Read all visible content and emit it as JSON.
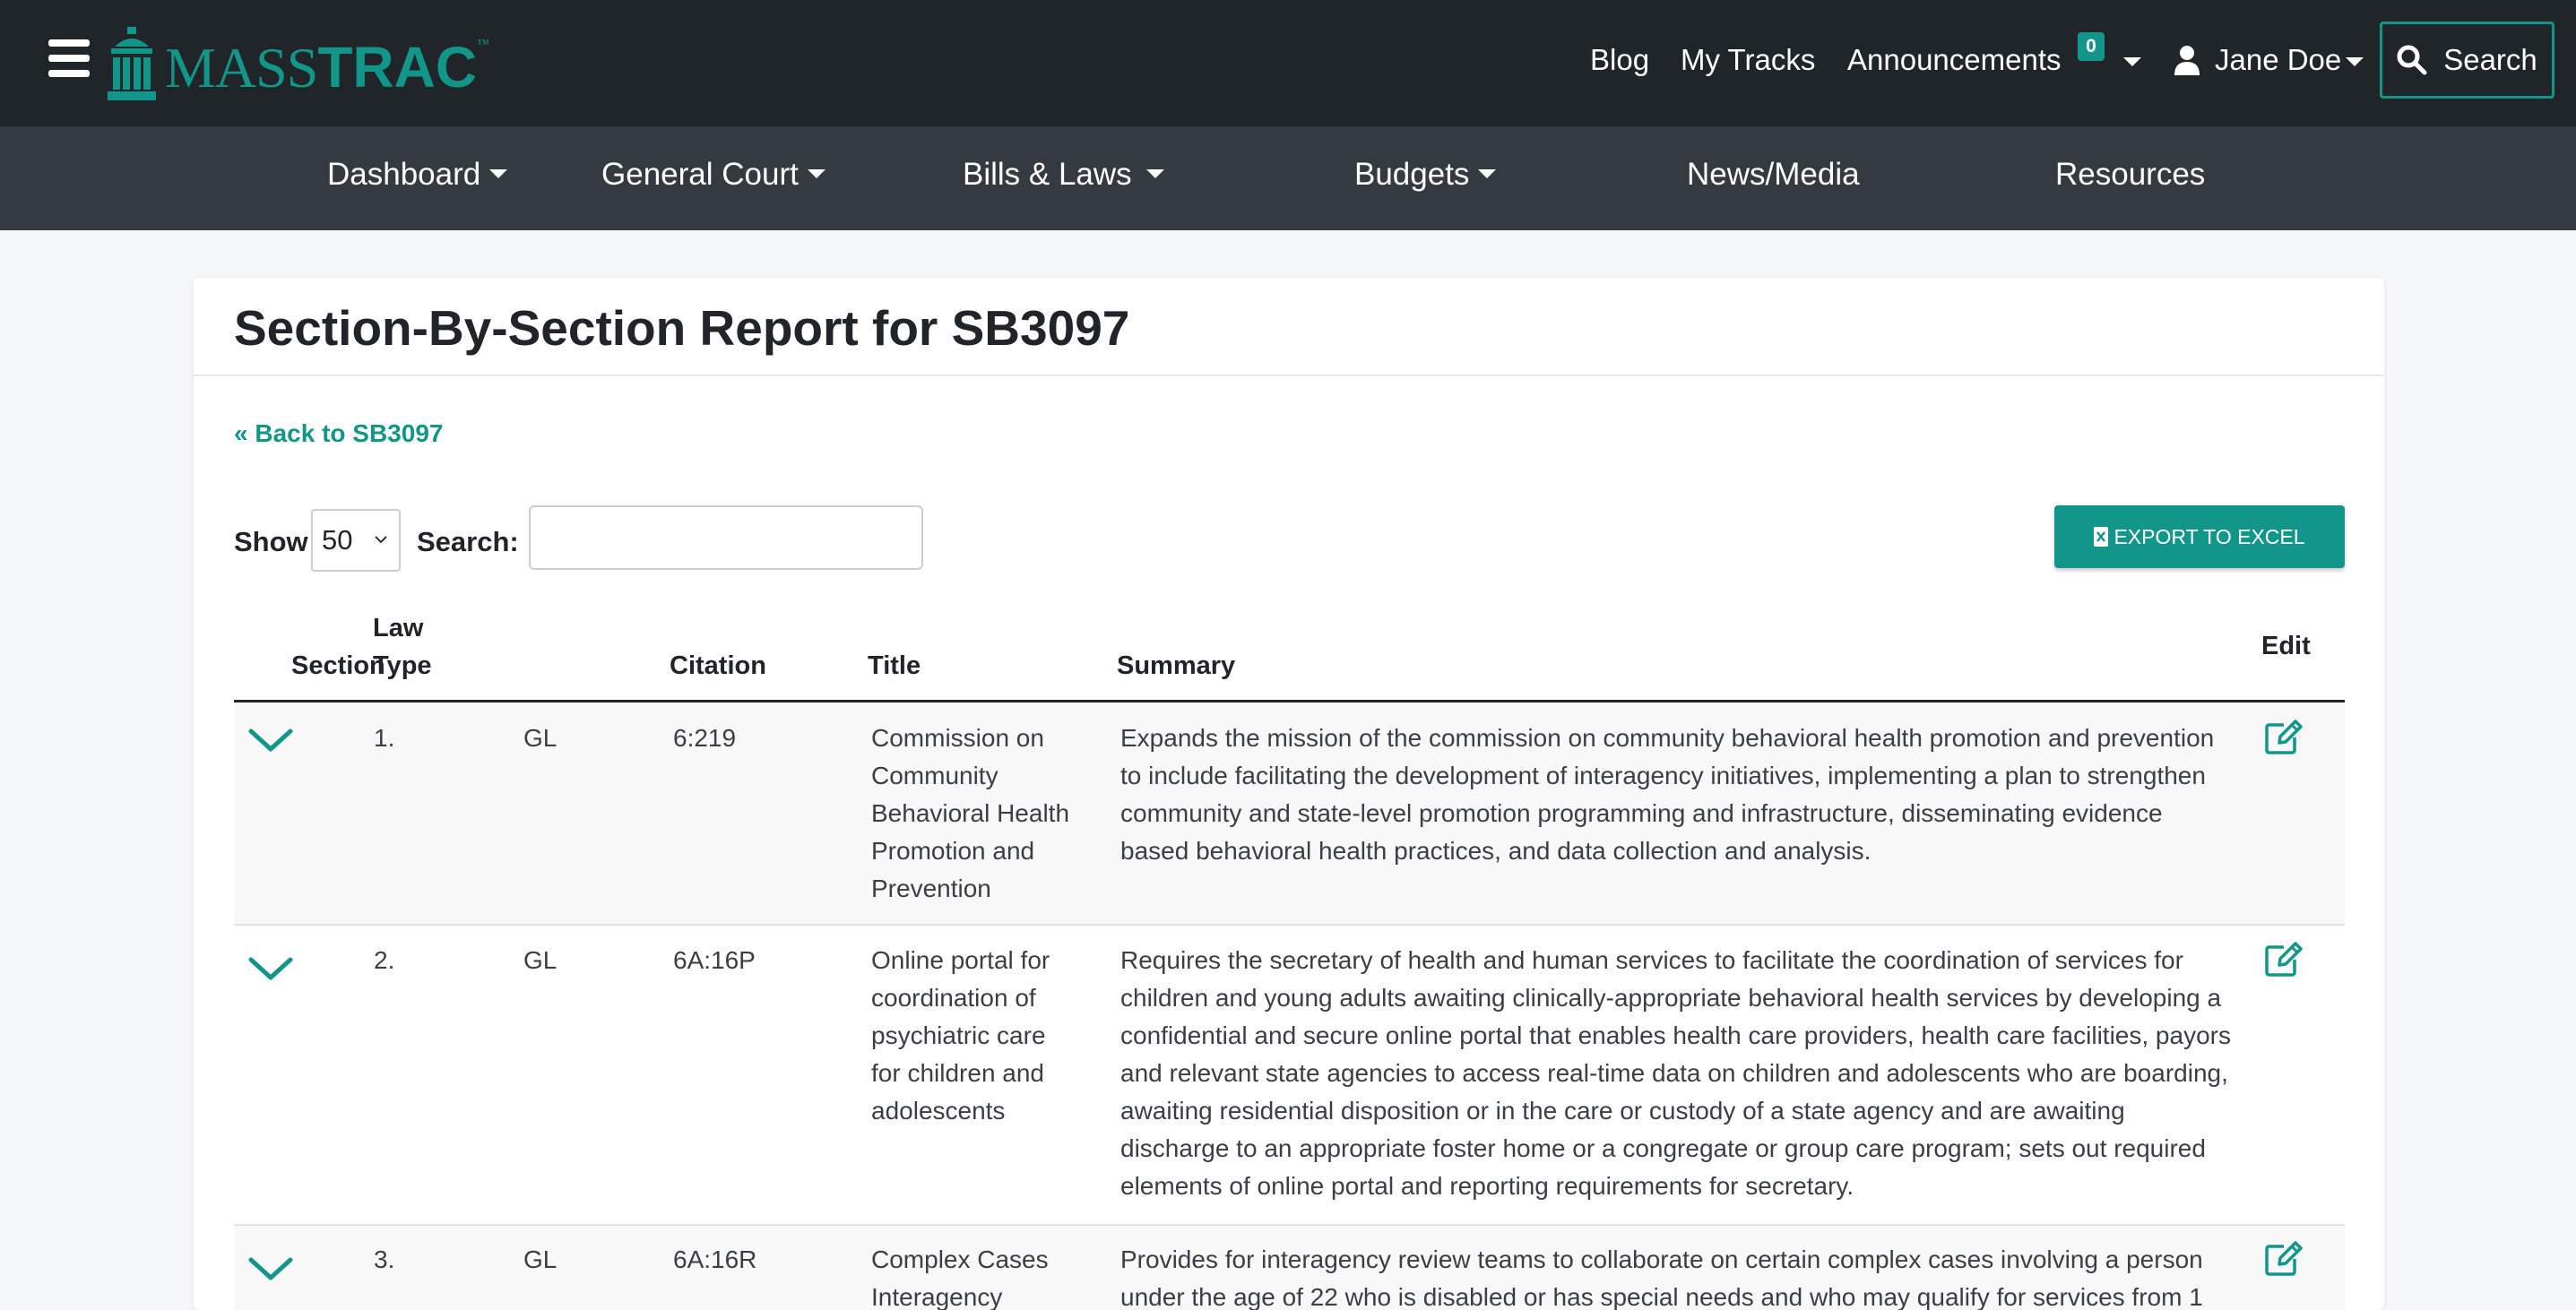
{
  "navbar": {
    "logo_text_light": "MASS",
    "logo_text_bold": "TRAC",
    "logo_tm": "™",
    "blog": "Blog",
    "my_tracks": "My Tracks",
    "announcements": "Announcements",
    "announcements_count": "0",
    "user_name": "Jane Doe",
    "search_label": "Search"
  },
  "subnav": {
    "items": [
      {
        "label": "Dashboard",
        "has_dropdown": true
      },
      {
        "label": "General Court",
        "has_dropdown": true
      },
      {
        "label": "Bills & Laws",
        "has_dropdown": true
      },
      {
        "label": "Budgets",
        "has_dropdown": true
      },
      {
        "label": "News/Media",
        "has_dropdown": false
      },
      {
        "label": "Resources",
        "has_dropdown": false
      }
    ]
  },
  "page": {
    "title": "Section-By-Section Report for SB3097",
    "back_link": "« Back to SB3097",
    "show_label": "Show",
    "show_value": "50",
    "search_label": "Search:",
    "search_value": "",
    "export_label": "EXPORT TO EXCEL"
  },
  "table": {
    "headers": {
      "section": "Section",
      "law_type_line1": "Law",
      "law_type_line2": "Type",
      "citation": "Citation",
      "title": "Title",
      "summary": "Summary",
      "edit": "Edit"
    },
    "rows": [
      {
        "section": "1.",
        "law_type": "GL",
        "citation": "6:219",
        "title": "Commission on Community Behavioral Health Promotion and Prevention",
        "summary": "Expands the mission of the commission on community behavioral health promotion and prevention to include facilitating the development of interagency initiatives, implementing a plan to strengthen community and state-level promotion programming and infrastructure, disseminating evidence based behavioral health practices, and data collection and analysis."
      },
      {
        "section": "2.",
        "law_type": "GL",
        "citation": "6A:16P",
        "title": "Online portal for coordination of psychiatric care for children and adolescents",
        "summary": "Requires the secretary of health and human services to facilitate the coordination of services for children and young adults awaiting clinically-appropriate behavioral health services by developing a confidential and secure online portal that enables health care providers, health care facilities, payors and relevant state agencies to access real-time data on children and adolescents who are boarding, awaiting residential disposition or in the care or custody of a state agency and are awaiting discharge to an appropriate foster home or a congregate or group care program; sets out required elements of online portal and reporting requirements for secretary."
      },
      {
        "section": "3.",
        "law_type": "GL",
        "citation": "6A:16R",
        "title": "Complex Cases Interagency",
        "summary": "Provides for interagency review teams to collaborate on certain complex cases involving a person under the age of 22 who is disabled or has special needs and who may qualify for services from 1"
      }
    ]
  },
  "colors": {
    "accent": "#13968a",
    "topbar": "#20252a",
    "subnav": "#343a40"
  }
}
